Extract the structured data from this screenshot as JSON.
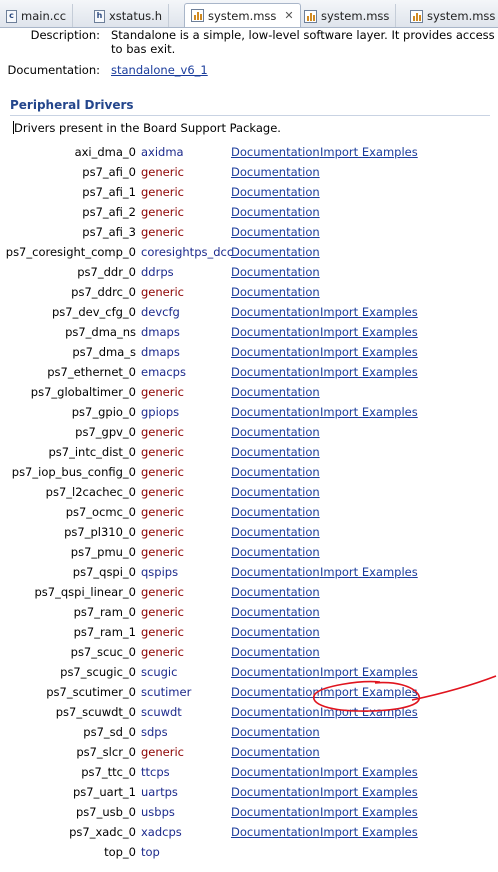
{
  "tabs": [
    {
      "label": "main.cc",
      "icon": "c-file-icon",
      "active": false
    },
    {
      "label": "xstatus.h",
      "icon": "h-file-icon",
      "active": false
    },
    {
      "label": "system.mss",
      "icon": "mss-file-icon",
      "active": true,
      "close": "✕"
    },
    {
      "label": "system.mss",
      "icon": "mss-file-icon",
      "active": false
    },
    {
      "label": "system.mss",
      "icon": "mss-file-icon",
      "active": false
    }
  ],
  "os_info": {
    "description_label": "Description:",
    "description_value": "Standalone is a simple, low-level software layer. It provides access to bas exit.",
    "documentation_label": "Documentation:",
    "documentation_link": "standalone_v6_1"
  },
  "peripheral": {
    "title": "Peripheral Drivers",
    "present_text": "Drivers present in the Board Support Package.",
    "doc_label": "Documentation",
    "import_label": "Import Examples",
    "rows": [
      {
        "instance": "axi_dma_0",
        "driver": "axidma",
        "color": "blue",
        "import": true
      },
      {
        "instance": "ps7_afi_0",
        "driver": "generic",
        "color": "red",
        "import": false
      },
      {
        "instance": "ps7_afi_1",
        "driver": "generic",
        "color": "red",
        "import": false
      },
      {
        "instance": "ps7_afi_2",
        "driver": "generic",
        "color": "red",
        "import": false
      },
      {
        "instance": "ps7_afi_3",
        "driver": "generic",
        "color": "red",
        "import": false
      },
      {
        "instance": "ps7_coresight_comp_0",
        "driver": "coresightps_dcc",
        "color": "blue",
        "import": false
      },
      {
        "instance": "ps7_ddr_0",
        "driver": "ddrps",
        "color": "blue",
        "import": false
      },
      {
        "instance": "ps7_ddrc_0",
        "driver": "generic",
        "color": "red",
        "import": false
      },
      {
        "instance": "ps7_dev_cfg_0",
        "driver": "devcfg",
        "color": "blue",
        "import": true
      },
      {
        "instance": "ps7_dma_ns",
        "driver": "dmaps",
        "color": "blue",
        "import": true
      },
      {
        "instance": "ps7_dma_s",
        "driver": "dmaps",
        "color": "blue",
        "import": true
      },
      {
        "instance": "ps7_ethernet_0",
        "driver": "emacps",
        "color": "blue",
        "import": true
      },
      {
        "instance": "ps7_globaltimer_0",
        "driver": "generic",
        "color": "red",
        "import": false
      },
      {
        "instance": "ps7_gpio_0",
        "driver": "gpiops",
        "color": "blue",
        "import": true
      },
      {
        "instance": "ps7_gpv_0",
        "driver": "generic",
        "color": "red",
        "import": false
      },
      {
        "instance": "ps7_intc_dist_0",
        "driver": "generic",
        "color": "red",
        "import": false
      },
      {
        "instance": "ps7_iop_bus_config_0",
        "driver": "generic",
        "color": "red",
        "import": false
      },
      {
        "instance": "ps7_l2cachec_0",
        "driver": "generic",
        "color": "red",
        "import": false
      },
      {
        "instance": "ps7_ocmc_0",
        "driver": "generic",
        "color": "red",
        "import": false
      },
      {
        "instance": "ps7_pl310_0",
        "driver": "generic",
        "color": "red",
        "import": false
      },
      {
        "instance": "ps7_pmu_0",
        "driver": "generic",
        "color": "red",
        "import": false
      },
      {
        "instance": "ps7_qspi_0",
        "driver": "qspips",
        "color": "blue",
        "import": true
      },
      {
        "instance": "ps7_qspi_linear_0",
        "driver": "generic",
        "color": "red",
        "import": false
      },
      {
        "instance": "ps7_ram_0",
        "driver": "generic",
        "color": "red",
        "import": false
      },
      {
        "instance": "ps7_ram_1",
        "driver": "generic",
        "color": "red",
        "import": false
      },
      {
        "instance": "ps7_scuc_0",
        "driver": "generic",
        "color": "red",
        "import": false
      },
      {
        "instance": "ps7_scugic_0",
        "driver": "scugic",
        "color": "blue",
        "import": true
      },
      {
        "instance": "ps7_scutimer_0",
        "driver": "scutimer",
        "color": "blue",
        "import": true
      },
      {
        "instance": "ps7_scuwdt_0",
        "driver": "scuwdt",
        "color": "blue",
        "import": true
      },
      {
        "instance": "ps7_sd_0",
        "driver": "sdps",
        "color": "blue",
        "import": false
      },
      {
        "instance": "ps7_slcr_0",
        "driver": "generic",
        "color": "red",
        "import": false
      },
      {
        "instance": "ps7_ttc_0",
        "driver": "ttcps",
        "color": "blue",
        "import": true
      },
      {
        "instance": "ps7_uart_1",
        "driver": "uartps",
        "color": "blue",
        "import": true
      },
      {
        "instance": "ps7_usb_0",
        "driver": "usbps",
        "color": "blue",
        "import": true
      },
      {
        "instance": "ps7_xadc_0",
        "driver": "xadcps",
        "color": "blue",
        "import": true
      },
      {
        "instance": "top_0",
        "driver": "top",
        "color": "blue",
        "import": false,
        "doc": false
      }
    ]
  },
  "colors": {
    "link": "#1a3c9c",
    "generic_driver": "#8b0000",
    "named_driver": "#1c2a8c",
    "section_title": "#24468c",
    "annotation": "#e0141e"
  }
}
